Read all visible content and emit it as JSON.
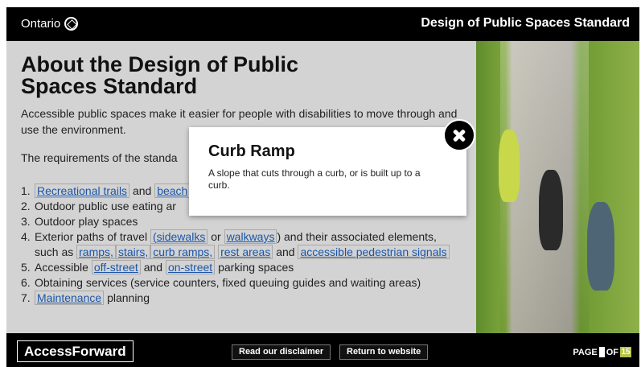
{
  "header": {
    "brand": "Ontario",
    "title": "Design of Public Spaces Standard"
  },
  "slide": {
    "heading": "About the Design of Public Spaces Standard",
    "intro": "Accessible public spaces make it easier for people with disabilities to move through and use the environment.",
    "requirements_lead": "The requirements of the standa",
    "list": {
      "i1": {
        "num": "1.",
        "link_a": "Recreational trails",
        "and": "and",
        "link_b": "beach"
      },
      "i2": {
        "num": "2.",
        "text": "Outdoor public use eating ar"
      },
      "i3": {
        "num": "3.",
        "text": "Outdoor play spaces"
      },
      "i4": {
        "num": "4.",
        "pre": "Exterior paths of travel",
        "paren_open": "(",
        "link_sidewalks": "sidewalks",
        "or": "or",
        "link_walkways": "walkways",
        "post": ") and their associated elements,",
        "such_as": "such as",
        "link_ramps": "ramps,",
        "link_stairs": "stairs,",
        "link_curb_ramps": "curb ramps,",
        "link_rest_areas": "rest areas",
        "and": "and",
        "link_signals": "accessible pedestrian signals"
      },
      "i5": {
        "num": "5.",
        "pre": "Accessible",
        "link_off": "off-street",
        "and": "and",
        "link_on": "on-street",
        "post": "parking spaces"
      },
      "i6": {
        "num": "6.",
        "text": "Obtaining services (service counters, fixed queuing guides and waiting areas)"
      },
      "i7": {
        "num": "7.",
        "link_maint": "Maintenance",
        "post": "planning"
      }
    }
  },
  "modal": {
    "title": "Curb Ramp",
    "body": "A slope that cuts through a curb, or is built up to a curb.",
    "close_icon": "close-icon"
  },
  "footer": {
    "brand": "AccessForward",
    "disclaimer": "Read our disclaimer",
    "return": "Return to website",
    "page_label": "PAGE",
    "page_current": "",
    "of_label": "OF",
    "page_total": "15"
  },
  "colors": {
    "link": "#1a55a8",
    "slide_bg": "#d3d3d3",
    "header_bg": "#000000",
    "page_total_bg": "#b8c24a"
  }
}
